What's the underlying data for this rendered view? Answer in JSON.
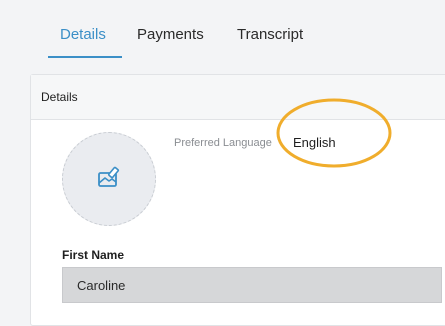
{
  "tabs": [
    {
      "label": "Details",
      "active": true
    },
    {
      "label": "Payments",
      "active": false
    },
    {
      "label": "Transcript",
      "active": false
    }
  ],
  "card": {
    "title": "Details"
  },
  "avatar": {
    "icon": "edit-image-icon"
  },
  "preferred_language": {
    "label": "Preferred Language",
    "value": "English"
  },
  "first_name": {
    "label": "First Name",
    "value": "Caroline"
  },
  "colors": {
    "accent": "#3b8fc7",
    "annotation": "#f0ad2c",
    "input_bg": "#d6d7d9"
  }
}
